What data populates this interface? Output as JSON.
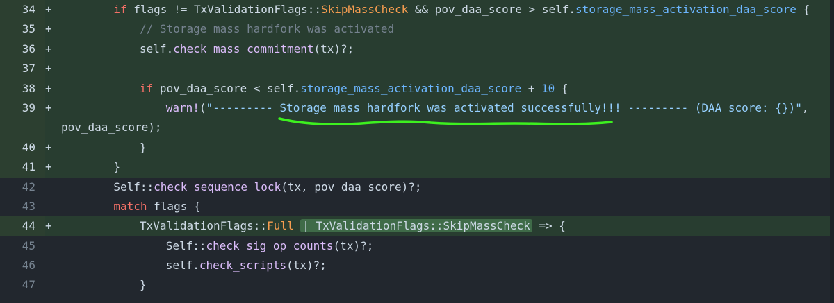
{
  "rows": [
    {
      "num": "34",
      "sign": "+",
      "type": "add",
      "indent": 8,
      "tokens": [
        {
          "t": "if",
          "c": "kw"
        },
        {
          "t": " flags != TxValidationFlags::",
          "c": ""
        },
        {
          "t": "SkipMassCheck",
          "c": "ty"
        },
        {
          "t": " && pov_daa_score > self.",
          "c": ""
        },
        {
          "t": "storage_mass_activation_daa_score",
          "c": "mt"
        },
        {
          "t": " {",
          "c": ""
        }
      ]
    },
    {
      "num": "35",
      "sign": "+",
      "type": "add",
      "indent": 12,
      "tokens": [
        {
          "t": "// Storage mass hardfork was activated",
          "c": "cm"
        }
      ]
    },
    {
      "num": "36",
      "sign": "+",
      "type": "add",
      "indent": 12,
      "tokens": [
        {
          "t": "self.",
          "c": ""
        },
        {
          "t": "check_mass_commitment",
          "c": "fn"
        },
        {
          "t": "(tx)?;",
          "c": ""
        }
      ]
    },
    {
      "num": "37",
      "sign": "+",
      "type": "add",
      "indent": 0,
      "tokens": []
    },
    {
      "num": "38",
      "sign": "+",
      "type": "add",
      "indent": 12,
      "tokens": [
        {
          "t": "if",
          "c": "kw"
        },
        {
          "t": " pov_daa_score < self.",
          "c": ""
        },
        {
          "t": "storage_mass_activation_daa_score",
          "c": "mt"
        },
        {
          "t": " + ",
          "c": ""
        },
        {
          "t": "10",
          "c": "nm"
        },
        {
          "t": " {",
          "c": ""
        }
      ]
    },
    {
      "num": "39",
      "sign": "+",
      "type": "add",
      "indent": 16,
      "wrap": true,
      "tokens": [
        {
          "t": "warn!",
          "c": "fn"
        },
        {
          "t": "(",
          "c": ""
        },
        {
          "t": "\"--------- Storage mass hardfork was activated successfully!!! --------- (DAA score: {})\"",
          "c": "st"
        },
        {
          "t": ",",
          "c": ""
        }
      ],
      "tokens2": [
        {
          "t": "pov_daa_score);",
          "c": ""
        }
      ]
    },
    {
      "num": "40",
      "sign": "+",
      "type": "add",
      "indent": 12,
      "tokens": [
        {
          "t": "}",
          "c": ""
        }
      ]
    },
    {
      "num": "41",
      "sign": "+",
      "type": "add",
      "indent": 8,
      "tokens": [
        {
          "t": "}",
          "c": ""
        }
      ]
    },
    {
      "num": "42",
      "sign": "",
      "type": "ctx",
      "indent": 8,
      "tokens": [
        {
          "t": "Self::",
          "c": ""
        },
        {
          "t": "check_sequence_lock",
          "c": "fn"
        },
        {
          "t": "(tx, pov_daa_score)?;",
          "c": ""
        }
      ]
    },
    {
      "num": "43",
      "sign": "",
      "type": "ctx",
      "indent": 8,
      "tokens": [
        {
          "t": "match",
          "c": "kw"
        },
        {
          "t": " flags {",
          "c": ""
        }
      ]
    },
    {
      "num": "44",
      "sign": "+",
      "type": "add",
      "indent": 12,
      "tokens": [
        {
          "t": "TxValidationFlags::",
          "c": ""
        },
        {
          "t": "Full",
          "c": "ty"
        },
        {
          "t": " ",
          "c": ""
        },
        {
          "t": "| TxValidationFlags::SkipMassCheck",
          "c": "hl"
        },
        {
          "t": " => {",
          "c": ""
        }
      ]
    },
    {
      "num": "45",
      "sign": "",
      "type": "ctx",
      "indent": 16,
      "tokens": [
        {
          "t": "Self::",
          "c": ""
        },
        {
          "t": "check_sig_op_counts",
          "c": "fn"
        },
        {
          "t": "(tx)?;",
          "c": ""
        }
      ]
    },
    {
      "num": "46",
      "sign": "",
      "type": "ctx",
      "indent": 16,
      "tokens": [
        {
          "t": "self.",
          "c": ""
        },
        {
          "t": "check_scripts",
          "c": "fn"
        },
        {
          "t": "(tx)?;",
          "c": ""
        }
      ]
    },
    {
      "num": "47",
      "sign": "",
      "type": "ctx",
      "indent": 12,
      "tokens": [
        {
          "t": "}",
          "c": ""
        }
      ]
    }
  ],
  "annotation": {
    "color": "#3df01f",
    "label": "green-underline"
  }
}
